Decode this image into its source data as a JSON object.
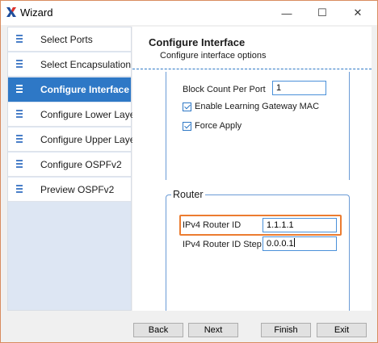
{
  "window": {
    "title": "Wizard",
    "controls": {
      "minimize": "—",
      "maximize": "☐",
      "close": "✕"
    }
  },
  "sidebar": {
    "items": [
      {
        "label": "Select Ports",
        "active": false
      },
      {
        "label": "Select Encapsulation",
        "active": false
      },
      {
        "label": "Configure Interface",
        "active": true
      },
      {
        "label": "Configure Lower Layer",
        "active": false
      },
      {
        "label": "Configure Upper Layer",
        "active": false
      },
      {
        "label": "Configure OSPFv2",
        "active": false
      },
      {
        "label": "Preview OSPFv2",
        "active": false
      }
    ]
  },
  "main": {
    "title": "Configure Interface",
    "subtitle": "Configure interface options",
    "block_count_label": "Block Count Per Port",
    "block_count_value": "1",
    "enable_learning_label": "Enable Learning Gateway MAC",
    "enable_learning_checked": true,
    "force_apply_label": "Force Apply",
    "force_apply_checked": true,
    "router_group_title": "Router",
    "router_id_label": "IPv4 Router ID",
    "router_id_value": "1.1.1.1",
    "router_id_step_label": "IPv4 Router ID Step",
    "router_id_step_value": "0.0.0.1"
  },
  "footer": {
    "back_label": "Back",
    "next_label": "Next",
    "finish_label": "Finish",
    "exit_label": "Exit"
  },
  "colors": {
    "accent": "#2e78c6",
    "highlight": "#ec7c30",
    "sidebar_bg": "#dde6f3"
  }
}
